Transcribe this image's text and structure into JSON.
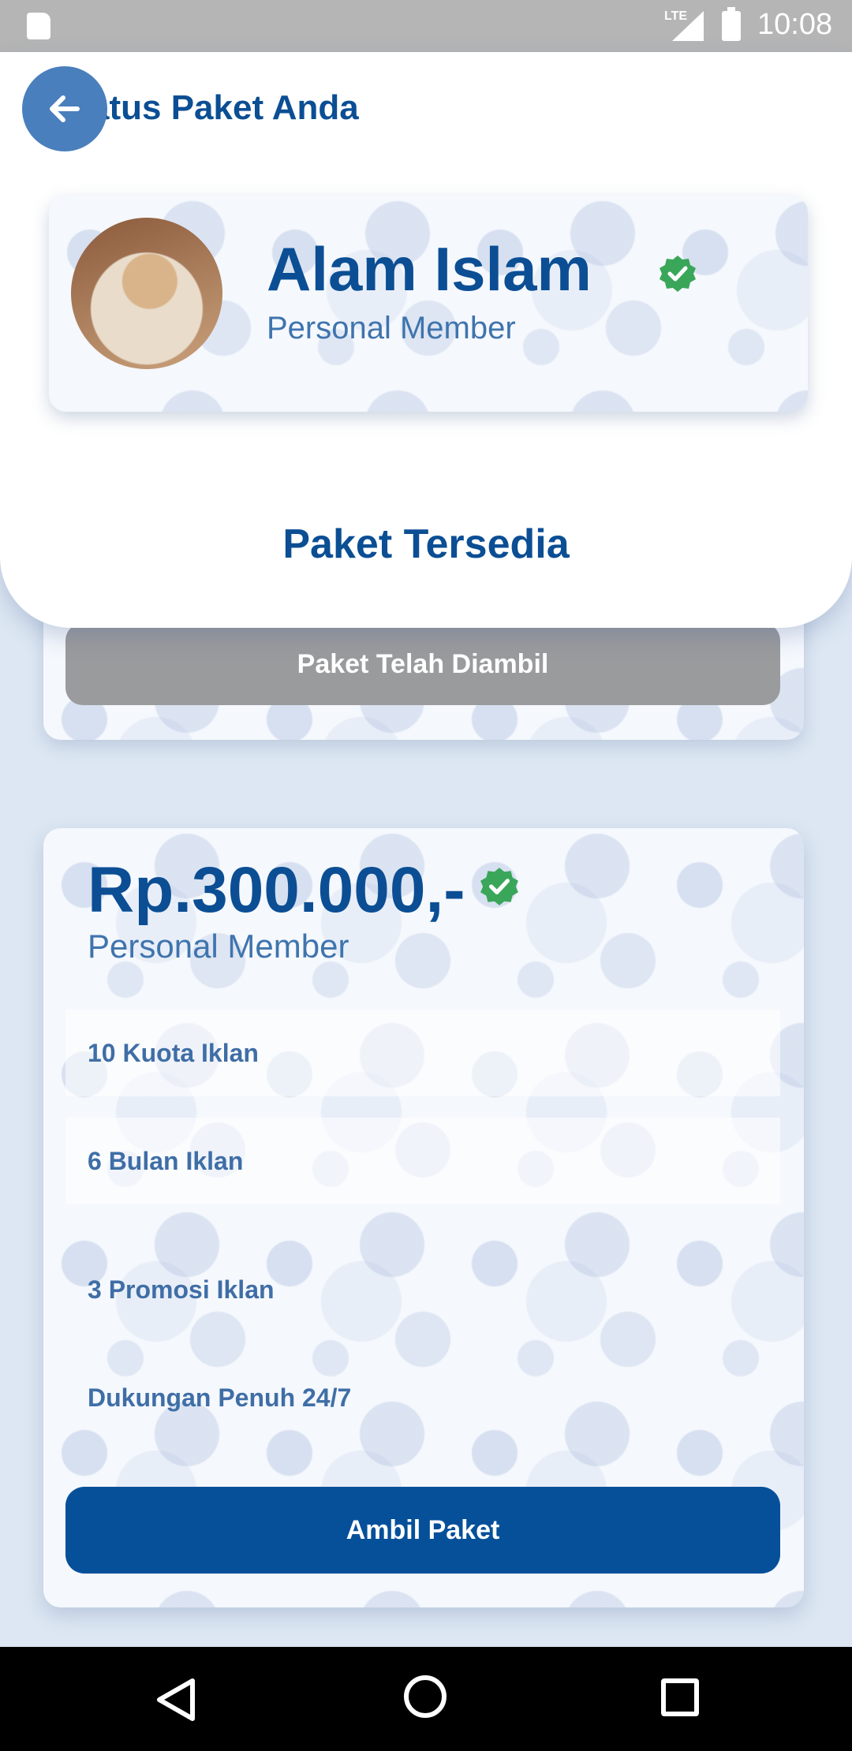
{
  "status_bar": {
    "network": "LTE",
    "time": "10:08"
  },
  "header": {
    "title": "Status Paket Anda"
  },
  "profile": {
    "name": "Alam Islam",
    "role": "Personal Member"
  },
  "section": {
    "title": "Paket Tersedia"
  },
  "taken_card": {
    "button_label": "Paket Telah Diambil"
  },
  "package": {
    "price": "Rp.300.000,-",
    "role": "Personal Member",
    "features": [
      "10 Kuota Iklan",
      "6 Bulan Iklan",
      "3 Promosi Iklan",
      "Dukungan Penuh 24/7"
    ],
    "button_label": "Ambil Paket"
  },
  "colors": {
    "primary": "#0b4e94",
    "verified": "#3aa65a",
    "disabled": "#9a9b9d"
  },
  "icons": [
    "back-arrow-icon",
    "verified-check-icon",
    "nav-back-icon",
    "nav-home-icon",
    "nav-recent-icon"
  ]
}
